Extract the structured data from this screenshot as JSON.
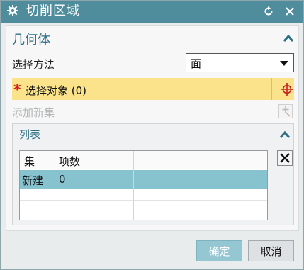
{
  "window": {
    "title": "切削区域"
  },
  "geometry_group": {
    "title": "几何体",
    "method_label": "选择方法",
    "method_value": "面",
    "select_required_mark": "*",
    "select_label": "选择对象 (0)",
    "add_new_set_label": "添加新集"
  },
  "list_group": {
    "title": "列表",
    "columns": [
      "集",
      "项数"
    ],
    "rows": [
      {
        "set": "新建",
        "count": "0"
      }
    ]
  },
  "footer": {
    "ok_label": "确定",
    "cancel_label": "取消"
  },
  "colors": {
    "titlebar": "#4f8c9c",
    "selection_highlight": "#fae38a",
    "row_selected": "#86c3cf",
    "accent_text": "#2f6f84"
  },
  "icons": [
    "gear-icon",
    "reset-icon",
    "close-icon",
    "collapse-icon",
    "dropdown-arrow-icon",
    "crosshair-icon",
    "add-set-icon",
    "delete-icon"
  ]
}
